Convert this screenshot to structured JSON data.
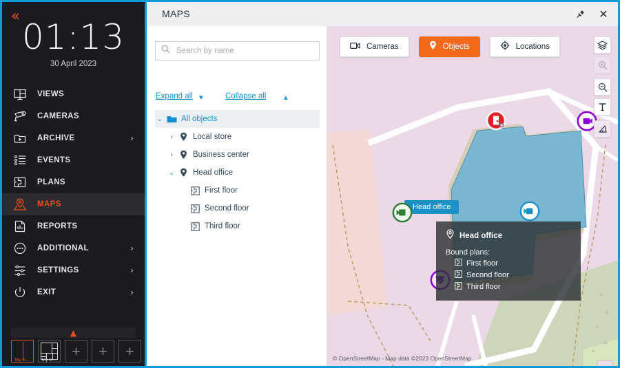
{
  "app": {
    "accent_orange": "#e8511f",
    "accent_blue": "#1690d2",
    "window_border": "#0f9bd7"
  },
  "sidebar": {
    "collapse_icon": "double-chevron-left-icon",
    "clock_time": "01:13",
    "clock_date": "30 April 2023",
    "items": [
      {
        "label": "VIEWS",
        "icon": "views-icon",
        "chevron": "",
        "active": false
      },
      {
        "label": "CAMERAS",
        "icon": "camera-icon",
        "chevron": "",
        "active": false
      },
      {
        "label": "ARCHIVE",
        "icon": "archive-icon",
        "chevron": "›",
        "active": false
      },
      {
        "label": "EVENTS",
        "icon": "events-icon",
        "chevron": "",
        "active": false
      },
      {
        "label": "PLANS",
        "icon": "plans-icon",
        "chevron": "",
        "active": false
      },
      {
        "label": "MAPS",
        "icon": "maps-icon",
        "chevron": "",
        "active": true
      },
      {
        "label": "REPORTS",
        "icon": "reports-icon",
        "chevron": "",
        "active": false
      },
      {
        "label": "ADDITIONAL",
        "icon": "ellipsis-icon",
        "chevron": "›",
        "active": false
      },
      {
        "label": "SETTINGS",
        "icon": "settings-icon",
        "chevron": "›",
        "active": false
      },
      {
        "label": "EXIT",
        "icon": "power-icon",
        "chevron": "›",
        "active": false
      }
    ],
    "views_bar_icon": "chevron-up-icon",
    "thumbnails": [
      {
        "label": "My vi…",
        "type": "layout-2col",
        "selected": true
      },
      {
        "label": "My vi…",
        "type": "layout-mixed",
        "selected": false
      },
      {
        "label": "+",
        "type": "add",
        "selected": false
      },
      {
        "label": "+",
        "type": "add",
        "selected": false
      },
      {
        "label": "+",
        "type": "add",
        "selected": false
      }
    ]
  },
  "window": {
    "title": "MAPS",
    "pin_icon": "pin-icon",
    "close_icon": "close-icon"
  },
  "tree_panel": {
    "search": {
      "value": "",
      "placeholder": "Search by name",
      "icon": "search-icon"
    },
    "expand_all": "Expand all",
    "collapse_all": "Collapse all",
    "expand_icon": "chevron-down-icon",
    "collapse_icon": "chevron-up-icon",
    "nodes": [
      {
        "label": "All objects",
        "icon": "folder-icon",
        "arrow": "⌄",
        "indent": 0,
        "selected": true,
        "blue": true
      },
      {
        "label": "Local store",
        "icon": "location-pin-icon",
        "arrow": "›",
        "indent": 1,
        "selected": false,
        "blue": false
      },
      {
        "label": "Business center",
        "icon": "location-pin-icon",
        "arrow": "›",
        "indent": 1,
        "selected": false,
        "blue": false
      },
      {
        "label": "Head office",
        "icon": "location-pin-icon",
        "arrow": "⌄",
        "indent": 1,
        "selected": false,
        "blue": false
      },
      {
        "label": "First floor",
        "icon": "plan-icon",
        "arrow": "",
        "indent": 2,
        "selected": false,
        "blue": false
      },
      {
        "label": "Second floor",
        "icon": "plan-icon",
        "arrow": "",
        "indent": 2,
        "selected": false,
        "blue": false
      },
      {
        "label": "Third floor",
        "icon": "plan-icon",
        "arrow": "",
        "indent": 2,
        "selected": false,
        "blue": false
      }
    ]
  },
  "map": {
    "chips": [
      {
        "label": "Cameras",
        "icon": "video-camera-icon",
        "active": false
      },
      {
        "label": "Objects",
        "icon": "map-pin-icon",
        "active": true
      },
      {
        "label": "Locations",
        "icon": "target-icon",
        "active": false
      }
    ],
    "tools": [
      {
        "name": "layers-icon",
        "disabled": false
      },
      {
        "name": "zoom-in-icon",
        "disabled": true
      },
      {
        "name": "zoom-out-icon",
        "disabled": false
      },
      {
        "name": "text-tool-icon",
        "disabled": false
      },
      {
        "name": "angle-tool-icon",
        "disabled": false
      }
    ],
    "object_label": "Head office",
    "markers": [
      {
        "name": "door-sensor-marker",
        "color": "#e01f26",
        "type": "door"
      },
      {
        "name": "camera-marker-green",
        "color": "#2e7d32",
        "type": "camera-left"
      },
      {
        "name": "camera-marker-blue",
        "color": "#1e90c8",
        "type": "camera-left"
      },
      {
        "name": "camera-marker-purple",
        "color": "#8f00d6",
        "type": "camera-left"
      },
      {
        "name": "dome-camera-marker-purple",
        "color": "#8f00d6",
        "type": "dome"
      }
    ],
    "popup": {
      "title": "Head office",
      "title_icon": "location-pin-outline-icon",
      "subtitle": "Bound plans:",
      "plans": [
        "First floor",
        "Second floor",
        "Third floor"
      ]
    },
    "attribution": "© OpenStreetMap - Map data ©2023 OpenStreetMap"
  }
}
